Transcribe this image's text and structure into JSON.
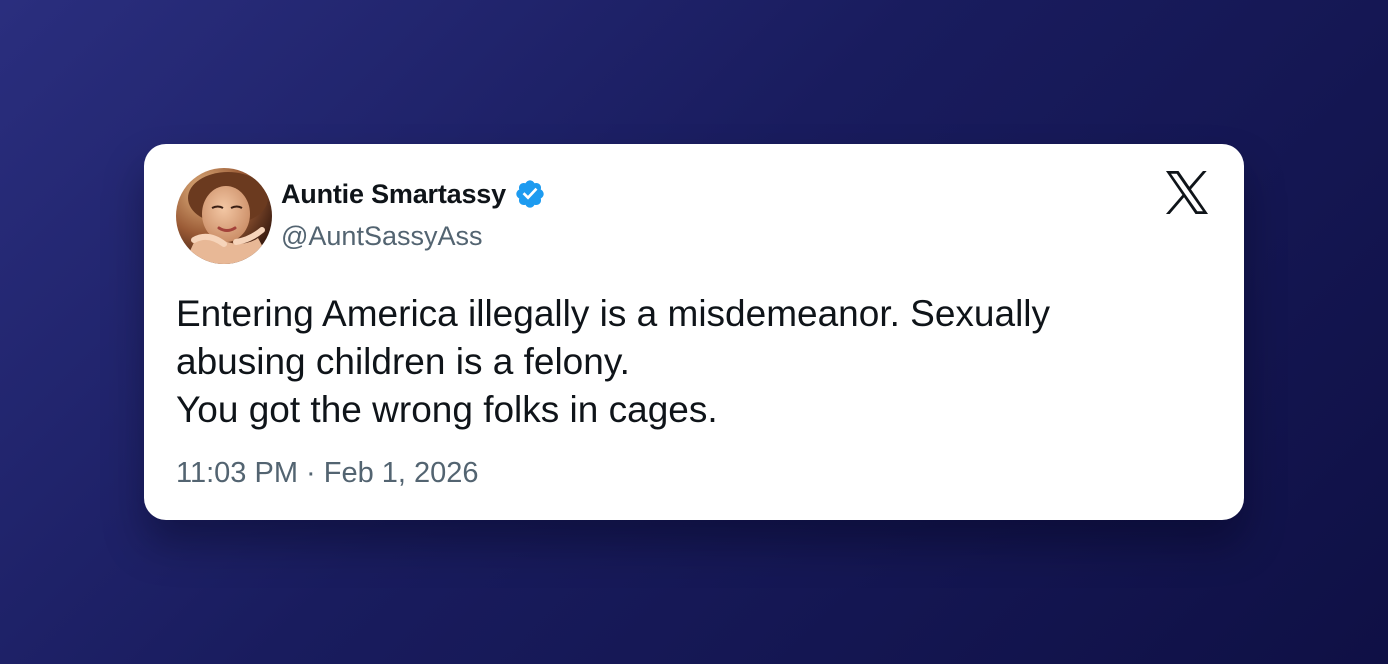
{
  "author": {
    "display_name": "Auntie Smartassy",
    "handle": "@AuntSassyAss",
    "verified": true,
    "avatar_icon": "profile-photo"
  },
  "tweet": {
    "text": "Entering America illegally is a misdemeanor.  Sexually abusing children is a felony.\nYou got the wrong folks in cages.",
    "timestamp": "11:03 PM · Feb 1, 2026"
  },
  "platform": {
    "logo_icon": "x-logo-icon"
  },
  "colors": {
    "background_start": "#2a2e7e",
    "background_end": "#0f1045",
    "card": "#ffffff",
    "text_primary": "#0f1419",
    "text_secondary": "#536471",
    "verified_blue": "#1d9bf0"
  }
}
